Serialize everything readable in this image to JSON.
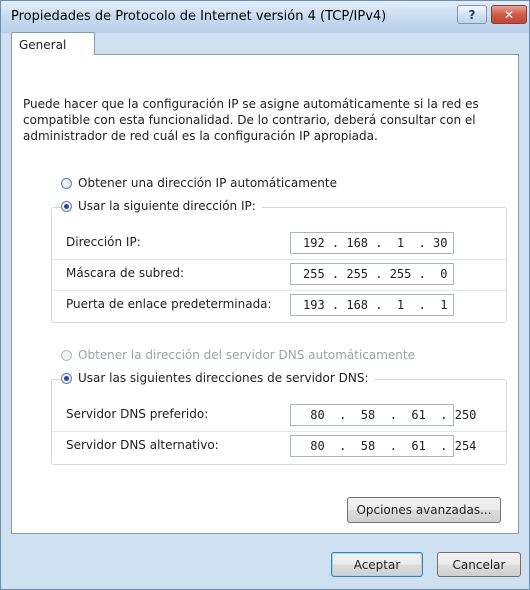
{
  "window": {
    "title": "Propiedades de Protocolo de Internet versión 4 (TCP/IPv4)",
    "help_glyph": "?",
    "close_glyph": "✕"
  },
  "tabs": [
    {
      "label": "General",
      "selected": true
    }
  ],
  "intro_text": "Puede hacer que la configuración IP se asigne automáticamente si la red es compatible con esta funcionalidad. De lo contrario, deberá consultar con el administrador de red cuál es la configuración IP apropiada.",
  "ip_mode": {
    "auto_label": "Obtener una dirección IP automáticamente",
    "manual_label": "Usar la siguiente dirección IP:",
    "selected": "manual"
  },
  "ip_fields": [
    {
      "label": "Dirección IP:",
      "value": "192 . 168 .  1  . 30"
    },
    {
      "label": "Máscara de subred:",
      "value": "255 . 255 . 255 .  0"
    },
    {
      "label": "Puerta de enlace predeterminada:",
      "value": "193 . 168 .  1  .  1"
    }
  ],
  "dns_mode": {
    "auto_label": "Obtener la dirección del servidor DNS automáticamente",
    "manual_label": "Usar las siguientes direcciones de servidor DNS:",
    "selected": "manual",
    "auto_disabled": true
  },
  "dns_fields": [
    {
      "label": "Servidor DNS preferido:",
      "value": " 80  .  58  .  61  . 250"
    },
    {
      "label": "Servidor DNS alternativo:",
      "value": " 80  .  58  .  61  . 254"
    }
  ],
  "buttons": {
    "advanced": "Opciones avanzadas...",
    "ok": "Aceptar",
    "cancel": "Cancelar"
  },
  "colors": {
    "window_frame": "#cfe0f1",
    "close_button": "#cf5c4a",
    "radio_dot": "#1b4e9b",
    "default_button_border": "#3c7fb1"
  }
}
